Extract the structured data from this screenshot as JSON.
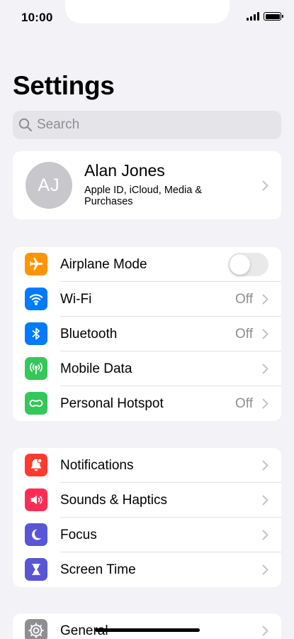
{
  "status_bar": {
    "time": "10:00"
  },
  "page": {
    "title": "Settings"
  },
  "search": {
    "placeholder": "Search"
  },
  "profile": {
    "initials": "AJ",
    "name": "Alan Jones",
    "subtitle": "Apple ID, iCloud, Media & Purchases"
  },
  "group1": [
    {
      "label": "Airplane Mode",
      "icon": "airplane-icon",
      "color": "#ff9500",
      "toggle": false
    },
    {
      "label": "Wi-Fi",
      "icon": "wifi-icon",
      "color": "#007aff",
      "value": "Off"
    },
    {
      "label": "Bluetooth",
      "icon": "bluetooth-icon",
      "color": "#007aff",
      "value": "Off"
    },
    {
      "label": "Mobile Data",
      "icon": "antenna-icon",
      "color": "#34c759"
    },
    {
      "label": "Personal Hotspot",
      "icon": "hotspot-icon",
      "color": "#34c759",
      "value": "Off"
    }
  ],
  "group2": [
    {
      "label": "Notifications",
      "icon": "bell-icon",
      "color": "#ff3b30"
    },
    {
      "label": "Sounds & Haptics",
      "icon": "speaker-icon",
      "color": "#ff2d55"
    },
    {
      "label": "Focus",
      "icon": "moon-icon",
      "color": "#5856d6"
    },
    {
      "label": "Screen Time",
      "icon": "hourglass-icon",
      "color": "#5856d6"
    }
  ],
  "group3": [
    {
      "label": "General",
      "icon": "gear-icon",
      "color": "#8e8e93"
    }
  ]
}
